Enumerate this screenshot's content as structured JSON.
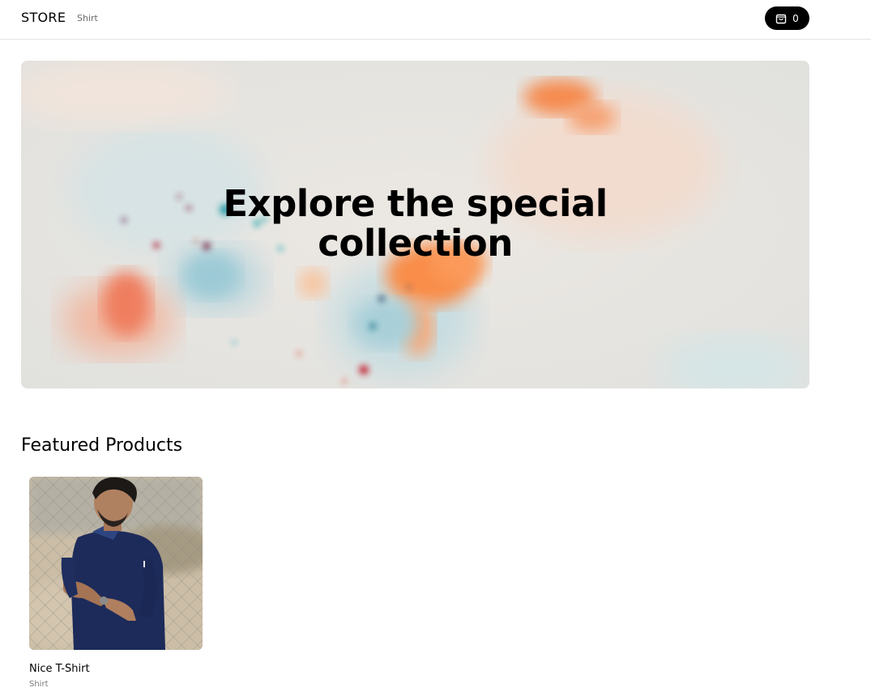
{
  "nav": {
    "brand": "STORE",
    "links": [
      {
        "label": "Shirt"
      }
    ],
    "cart": {
      "icon": "shopping-bag-icon",
      "count": "0"
    }
  },
  "hero": {
    "title_line1": "Explore the special",
    "title_line2": "collection",
    "background": "abstract paint splash"
  },
  "featured": {
    "heading": "Featured Products",
    "products": [
      {
        "name": "Nice T-Shirt",
        "category": "Shirt",
        "image": "man in navy polo shirt by chain-link fence"
      }
    ]
  },
  "colors": {
    "accent": "#000000",
    "muted_text": "#7a7a7a",
    "border": "#e5e5e5"
  }
}
